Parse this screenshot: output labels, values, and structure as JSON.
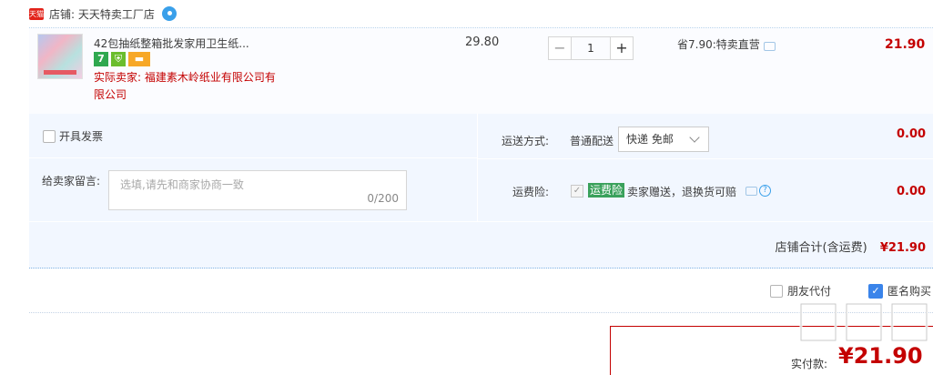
{
  "shop": {
    "badge": "天猫",
    "label": "店铺: 天天特卖工厂店"
  },
  "product": {
    "title": "42包抽纸整箱批发家用卫生纸...",
    "icon_seven": "7",
    "seller": "实际卖家: 福建素木岭纸业有限公司有限公司",
    "unit_price": "29.80",
    "quantity": "1",
    "minus_label": "−",
    "plus_label": "+",
    "promo": "省7.90:特卖直营",
    "total": "21.90"
  },
  "options": {
    "invoice_label": "开具发票",
    "memo_label": "给卖家留言:",
    "memo_placeholder": "选填,请先和商家协商一致",
    "memo_count": "0/200",
    "shipping_label": "运送方式:",
    "shipping_mode": "普通配送",
    "shipping_select": "快递 免邮",
    "shipping_fee": "0.00",
    "insurance_label": "运费险:",
    "insurance_tag": "运费险",
    "insurance_text": "卖家赠送，退换货可赔",
    "insurance_fee": "0.00",
    "subtotal_label": "店铺合计(含运费)",
    "subtotal_value": "¥21.90"
  },
  "footer": {
    "friend_pay": "朋友代付",
    "anonymous": "匿名购买",
    "pay_label": "实付款:",
    "pay_amount": "¥21.90"
  },
  "colors": {
    "price_red": "#c40000",
    "accent_blue": "#3a84ea",
    "panel_bg": "#f2f7ff"
  }
}
